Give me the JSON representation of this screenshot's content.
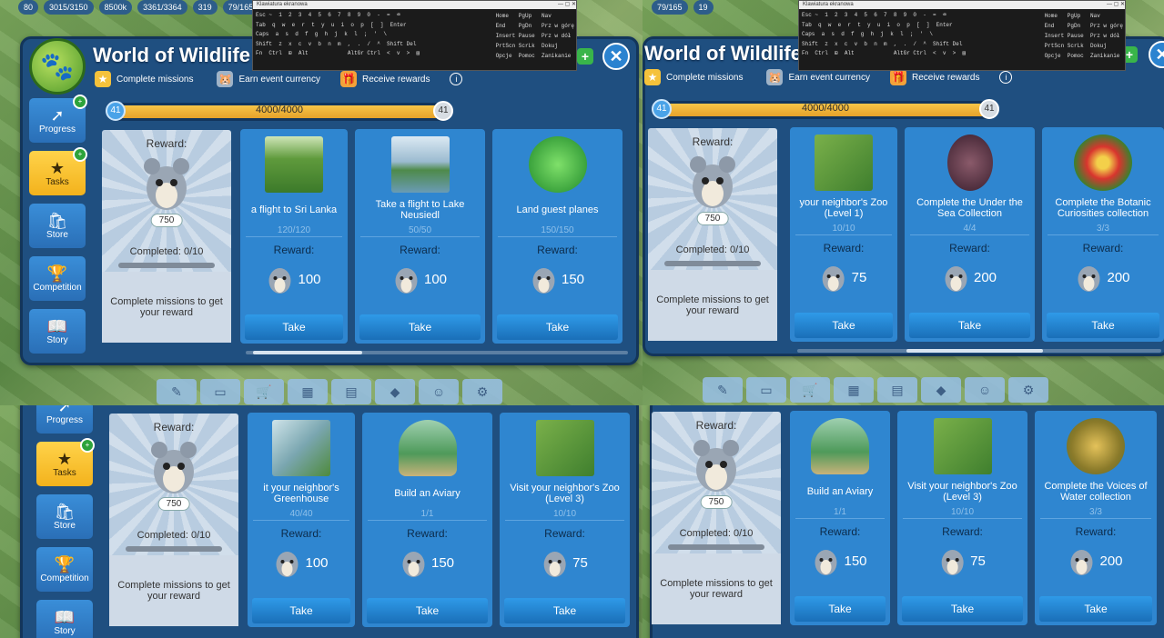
{
  "hud": {
    "items": [
      "80",
      "3015/3150",
      "8500k",
      "3361/3364",
      "319",
      "79/165",
      "19"
    ]
  },
  "title": "World of Wildlife",
  "steps": [
    "Complete missions",
    "Earn event currency",
    "Receive rewards"
  ],
  "progress": {
    "left_level": "41",
    "right_level": "41",
    "text": "4000/4000",
    "fill_fraction": 1.0
  },
  "sidebar": [
    {
      "label": "Progress",
      "icon": "arrow-icon"
    },
    {
      "label": "Tasks",
      "icon": "star-icon"
    },
    {
      "label": "Store",
      "icon": "bag-icon"
    },
    {
      "label": "Competition",
      "icon": "trophy-icon"
    },
    {
      "label": "Story",
      "icon": "book-icon"
    }
  ],
  "reward_panel": {
    "heading": "Reward:",
    "count": "750",
    "completed": "Completed: 0/10",
    "footer": "Complete missions to get your reward"
  },
  "keyboard": {
    "title": "Klawiatura ekranowa",
    "rows": [
      "Esc ~  1  2  3  4  5  6  7  8  9  0  -  =  ⌫",
      "Tab  q  w  e  r  t  y  u  i  o  p  [  ]  Enter",
      "Caps  a  s  d  f  g  h  j  k  l  ;  '  \\",
      "Shift  z  x  c  v  b  n  m  ,  .  /  ^  Shift Del",
      "Fn  Ctrl  ⊞  Alt            AltGr Ctrl  <  v  >  ▤"
    ],
    "nav": [
      "Home   PgUp   Nav",
      "End    PgDn   Prz w górę",
      "Insert Pause  Prz w dół",
      "PrtScn ScrLk  Dokuj",
      "Opcje  Pomoc  Zanikanie"
    ]
  },
  "take_label": "Take",
  "reward_label": "Reward:",
  "quadrants": [
    {
      "cards": [
        {
          "name": "a flight to Sri Lanka",
          "progress": "120/120",
          "reward": "100",
          "thumb": "tea-hills"
        },
        {
          "name": "Take a flight to Lake Neusiedl",
          "progress": "50/50",
          "reward": "100",
          "thumb": "lake"
        },
        {
          "name": "Land guest planes",
          "progress": "150/150",
          "reward": "150",
          "thumb": "radar"
        }
      ]
    },
    {
      "cards": [
        {
          "name": "your neighbor's Zoo (Level 1)",
          "progress": "10/10",
          "reward": "75",
          "thumb": "zoo"
        },
        {
          "name": "Complete the Under the Sea Collection",
          "progress": "4/4",
          "reward": "200",
          "thumb": "anglerfish"
        },
        {
          "name": "Complete the Botanic Curiosities collection",
          "progress": "3/3",
          "reward": "200",
          "thumb": "flower"
        }
      ]
    },
    {
      "cards": [
        {
          "name": "it your neighbor's Greenhouse",
          "progress": "40/40",
          "reward": "100",
          "thumb": "greenhouse"
        },
        {
          "name": "Build an Aviary",
          "progress": "1/1",
          "reward": "150",
          "thumb": "aviary"
        },
        {
          "name": "Visit your neighbor's Zoo (Level 3)",
          "progress": "10/10",
          "reward": "75",
          "thumb": "zoo"
        }
      ]
    },
    {
      "cards": [
        {
          "name": "Build an Aviary",
          "progress": "1/1",
          "reward": "150",
          "thumb": "aviary"
        },
        {
          "name": "Visit your neighbor's Zoo (Level 3)",
          "progress": "10/10",
          "reward": "75",
          "thumb": "zoo"
        },
        {
          "name": "Complete the Voices of Water collection",
          "progress": "3/3",
          "reward": "200",
          "thumb": "frog"
        }
      ]
    }
  ],
  "tray_icons": [
    "pen-icon",
    "chest-icon",
    "cart-icon",
    "crate-icon",
    "map-icon",
    "diamond-icon",
    "people-icon",
    "gear-icon"
  ]
}
